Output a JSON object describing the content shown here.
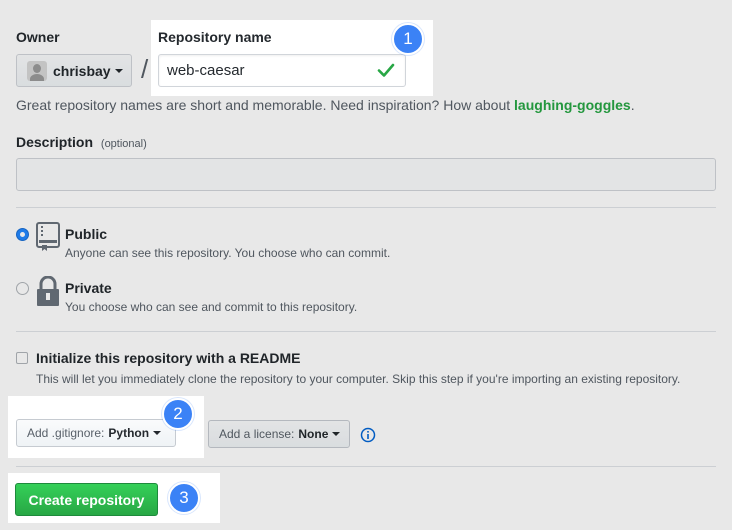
{
  "owner": {
    "label": "Owner",
    "username": "chrisbay"
  },
  "separator": "/",
  "repository": {
    "label": "Repository name",
    "value": "web-caesar"
  },
  "hint": {
    "text": "Great repository names are short and memorable. Need inspiration? How about",
    "suggestion": "laughing-goggles",
    "end": "."
  },
  "description": {
    "label": "Description",
    "optional": "(optional)",
    "value": ""
  },
  "visibility": {
    "public": {
      "title": "Public",
      "desc": "Anyone can see this repository. You choose who can commit.",
      "selected": true
    },
    "private": {
      "title": "Private",
      "desc": "You choose who can see and commit to this repository.",
      "selected": false
    }
  },
  "init_readme": {
    "title": "Initialize this repository with a README",
    "desc": "This will let you immediately clone the repository to your computer. Skip this step if you're importing an existing repository."
  },
  "gitignore": {
    "prefix": "Add .gitignore:",
    "value": "Python"
  },
  "license": {
    "prefix": "Add a license:",
    "value": "None"
  },
  "create_button": "Create repository",
  "steps": {
    "one": "1",
    "two": "2",
    "three": "3"
  },
  "colors": {
    "accent": "#3b82f6",
    "create_green": "#2ea44f",
    "suggestion_green": "#28a745",
    "check_green": "#28a745",
    "radio_blue": "#2188ff"
  },
  "icons": {
    "check": "check-icon",
    "public_repo": "repo-book-icon",
    "private_repo": "lock-icon",
    "info": "info-icon",
    "caret": "caret-down-icon"
  }
}
